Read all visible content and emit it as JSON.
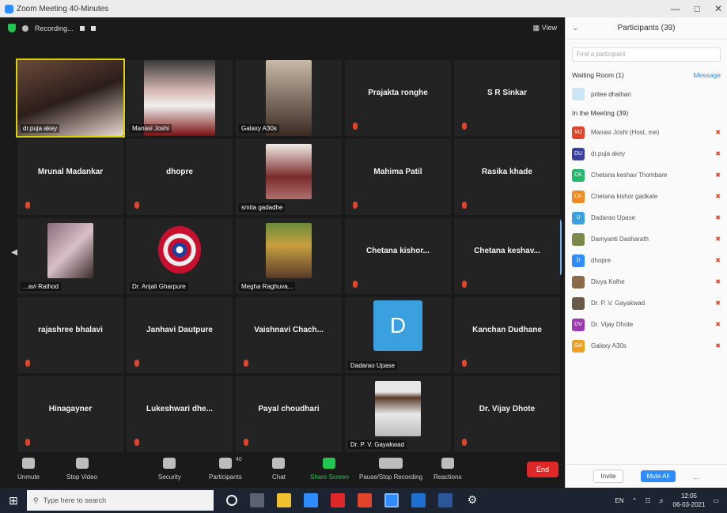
{
  "window": {
    "title": "Zoom Meeting 40-Minutes"
  },
  "topbar": {
    "recording": "Recording...",
    "view": "View"
  },
  "tiles": [
    {
      "id": "t1",
      "label": "dr.puja akey",
      "type": "video"
    },
    {
      "id": "t2",
      "label": "Manasi Joshi",
      "type": "video"
    },
    {
      "id": "t3",
      "label": "Galaxy A30s",
      "type": "video"
    },
    {
      "id": "t4",
      "label": "Prajakta ronghe",
      "type": "name"
    },
    {
      "id": "t5",
      "label": "S R Sinkar",
      "type": "name"
    },
    {
      "id": "t6",
      "label": "Mrunal Madankar",
      "type": "name"
    },
    {
      "id": "t7",
      "label": "dhopre",
      "type": "name"
    },
    {
      "id": "t8",
      "label": "smita gadadhe",
      "type": "video"
    },
    {
      "id": "t9",
      "label": "Mahima Patil",
      "type": "name"
    },
    {
      "id": "t10",
      "label": "Rasika khade",
      "type": "name"
    },
    {
      "id": "t11",
      "label": "...avi Rathod",
      "type": "video"
    },
    {
      "id": "t12",
      "label": "Dr. Anjali Gharpure",
      "type": "video"
    },
    {
      "id": "t13",
      "label": "Megha Raghuva...",
      "type": "video"
    },
    {
      "id": "t14",
      "label": "Chetana kishor...",
      "type": "name"
    },
    {
      "id": "t15",
      "label": "Chetana keshav...",
      "type": "name"
    },
    {
      "id": "t16",
      "label": "rajashree bhalavi",
      "type": "name"
    },
    {
      "id": "t17",
      "label": "Janhavi Dautpure",
      "type": "name"
    },
    {
      "id": "t18",
      "label": "Vaishnavi Chach...",
      "type": "name"
    },
    {
      "id": "t19",
      "label": "Dadarao Upase",
      "type": "video",
      "avatar": "D"
    },
    {
      "id": "t20",
      "label": "Kanchan Dudhane",
      "type": "name"
    },
    {
      "id": "t21",
      "label": "Hinagayner",
      "type": "name"
    },
    {
      "id": "t22",
      "label": "Lukeshwari dhe...",
      "type": "name"
    },
    {
      "id": "t23",
      "label": "Payal choudhari",
      "type": "name"
    },
    {
      "id": "t24",
      "label": "Dr. P. V. Gayakwad",
      "type": "video"
    },
    {
      "id": "t25",
      "label": "Dr. Vijay Dhote",
      "type": "name"
    }
  ],
  "toolbar": {
    "unmute": "Unmute",
    "stop_video": "Stop Video",
    "security": "Security",
    "participants": "Participants",
    "participants_count": "40",
    "chat": "Chat",
    "share_screen": "Share Screen",
    "pause_recording": "Pause/Stop Recording",
    "reactions": "Reactions",
    "end": "End"
  },
  "panel": {
    "title": "Participants (39)",
    "search_placeholder": "Find a participant",
    "waiting_room": "Waiting Room (1)",
    "message": "Message",
    "waiting_name": "pritee dhaihan",
    "in_meeting": "In the Meeting (39)",
    "participants": [
      {
        "initials": "MJ",
        "name": "Manasi Joshi (Host, me)",
        "color": "#e0452b"
      },
      {
        "initials": "DU",
        "name": "dr.puja akey",
        "color": "#3b3f9e"
      },
      {
        "initials": "CK",
        "name": "Chetana keshav Thombare",
        "color": "#23b86b"
      },
      {
        "initials": "CK",
        "name": "Chetana kishor gadkale",
        "color": "#f08a24"
      },
      {
        "initials": "U",
        "name": "Dadarao Upase",
        "color": "#3aa0e0"
      },
      {
        "initials": "",
        "name": "Damyanti Dasharath",
        "color": "#7a8a4a"
      },
      {
        "initials": "D",
        "name": "dhopre",
        "color": "#2d8cff"
      },
      {
        "initials": "",
        "name": "Divya Kolhe",
        "color": "#8a6a4a"
      },
      {
        "initials": "",
        "name": "Dr. P. V. Gayakwad",
        "color": "#6a5a4a"
      },
      {
        "initials": "DV",
        "name": "Dr. Vijay Dhote",
        "color": "#9a3ab0"
      },
      {
        "initials": "GA",
        "name": "Galaxy A30s",
        "color": "#f0a020"
      }
    ],
    "invite": "Invite",
    "mute_all": "Mute All",
    "more": "..."
  },
  "taskbar": {
    "search_placeholder": "Type here to search",
    "time": "12:05",
    "date": "06-03-2021",
    "lang": "EN"
  }
}
